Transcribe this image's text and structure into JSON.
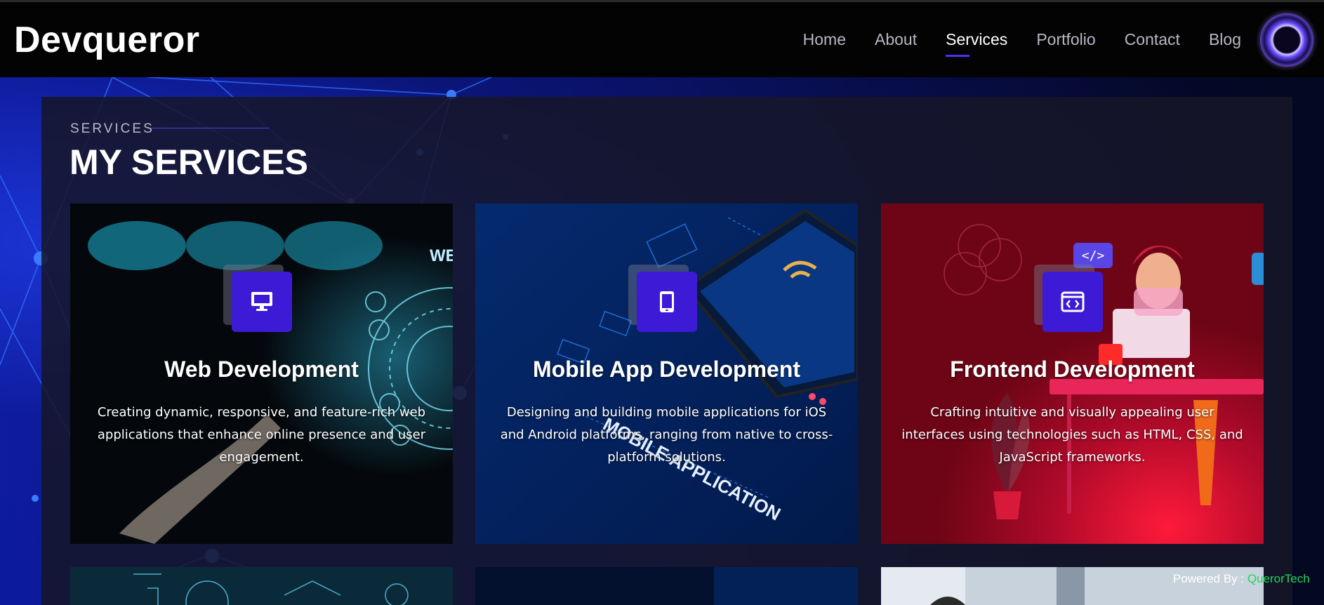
{
  "header": {
    "logo": "Devqueror",
    "nav": [
      "Home",
      "About",
      "Services",
      "Portfolio",
      "Contact",
      "Blog"
    ],
    "active_nav": "Services"
  },
  "section": {
    "eyebrow": "SERVICES",
    "title": "MY SERVICES"
  },
  "services": [
    {
      "icon": "monitor-icon",
      "title": "Web Development",
      "description": "Creating dynamic, responsive, and feature-rich web applications that enhance online presence and user engagement."
    },
    {
      "icon": "mobile-phone-icon",
      "title": "Mobile App Development",
      "description": "Designing and building mobile applications for iOS and Android platforms, ranging from native to cross-platform solutions."
    },
    {
      "icon": "code-window-icon",
      "title": "Frontend Development",
      "description": "Crafting intuitive and visually appealing user interfaces using technologies such as HTML, CSS, and JavaScript frameworks."
    }
  ],
  "card_art_text": {
    "web": "WEB DEVELOP",
    "mobile": "MOBILE APPLICATION",
    "frontend_badge": "</>"
  },
  "footer": {
    "powered_label": "Powered By : ",
    "powered_brand": "QuerorTech"
  },
  "colors": {
    "accent": "#3d1bd6",
    "nav_underline": "#4b2ff0",
    "brand_green": "#1fd65a"
  }
}
